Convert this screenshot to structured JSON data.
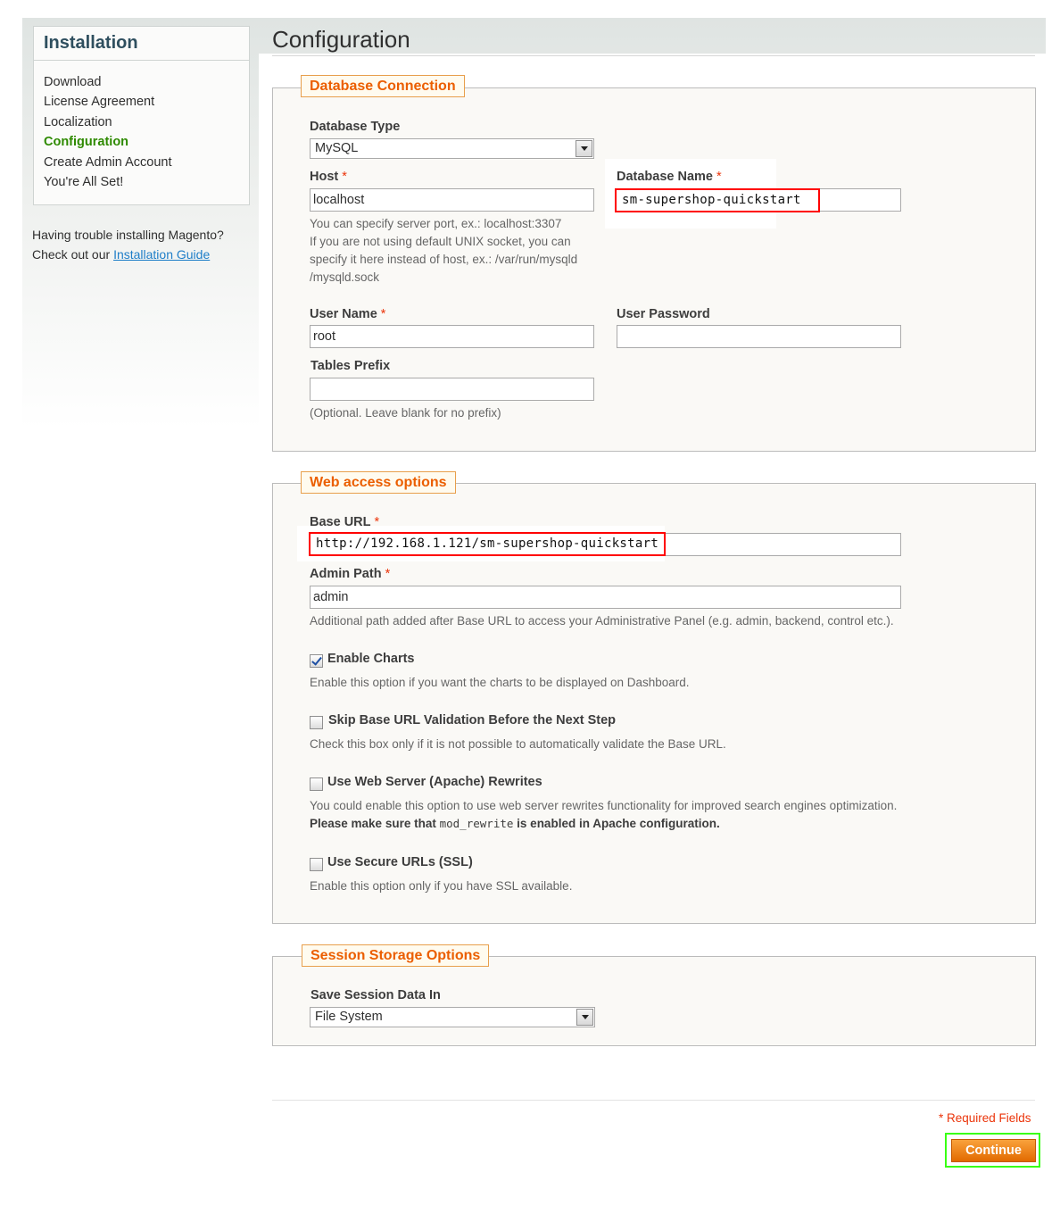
{
  "sidebar": {
    "title": "Installation",
    "steps": [
      {
        "label": "Download"
      },
      {
        "label": "License Agreement"
      },
      {
        "label": "Localization"
      },
      {
        "label": "Configuration",
        "active": true
      },
      {
        "label": "Create Admin Account"
      },
      {
        "label": "You're All Set!"
      }
    ],
    "help_line1": "Having trouble installing Magento?",
    "help_line2_prefix": "Check out our",
    "help_link": "Installation Guide"
  },
  "main": {
    "title": "Configuration"
  },
  "database_connection": {
    "legend": "Database Connection",
    "db_type_label": "Database Type",
    "db_type_value": "MySQL",
    "host_label": "Host",
    "host_value": "localhost",
    "host_note_1": "You can specify server port, ex.: localhost:3307",
    "host_note_2": "If you are not using default UNIX socket, you can",
    "host_note_3": "specify it here instead of host, ex.: /var/run/mysqld",
    "host_note_4": "/mysqld.sock",
    "db_name_label": "Database Name",
    "db_name_value": "sm-supershop-quickstart",
    "user_label": "User Name",
    "user_value": "root",
    "password_label": "User Password",
    "password_value": "",
    "prefix_label": "Tables Prefix",
    "prefix_value": "",
    "prefix_note": "(Optional. Leave blank for no prefix)"
  },
  "web_access": {
    "legend": "Web access options",
    "base_url_label": "Base URL",
    "base_url_value": "http://192.168.1.121/sm-supershop-quickstart",
    "admin_path_label": "Admin Path",
    "admin_path_value": "admin",
    "admin_path_note": "Additional path added after Base URL to access your Administrative Panel (e.g. admin, backend, control etc.).",
    "enable_charts_label": "Enable Charts",
    "enable_charts_checked": true,
    "enable_charts_note": "Enable this option if you want the charts to be displayed on Dashboard.",
    "skip_validation_label": "Skip Base URL Validation Before the Next Step",
    "skip_validation_checked": false,
    "skip_validation_note": "Check this box only if it is not possible to automatically validate the Base URL.",
    "rewrites_label": "Use Web Server (Apache) Rewrites",
    "rewrites_checked": false,
    "rewrites_note": "You could enable this option to use web server rewrites functionality for improved search engines optimization.",
    "rewrites_warning_prefix": "Please make sure that",
    "rewrites_warning_code": "mod_rewrite",
    "rewrites_warning_suffix": "is enabled in Apache configuration.",
    "ssl_label": "Use Secure URLs (SSL)",
    "ssl_checked": false,
    "ssl_note": "Enable this option only if you have SSL available."
  },
  "session": {
    "legend": "Session Storage Options",
    "save_label": "Save Session Data In",
    "save_value": "File System"
  },
  "footer": {
    "required_note": "* Required Fields",
    "continue_label": "Continue"
  },
  "colors": {
    "legend_text": "#eb5e00",
    "active_step": "#2e8a00",
    "link": "#1e7ec8",
    "required": "#eb340a",
    "continue_bg": "#f18200",
    "highlight_red": "#ff0000",
    "highlight_green": "#39ff14"
  },
  "icons": {
    "select_arrow": "chevron-down-icon",
    "checkbox": "checkbox-icon"
  }
}
